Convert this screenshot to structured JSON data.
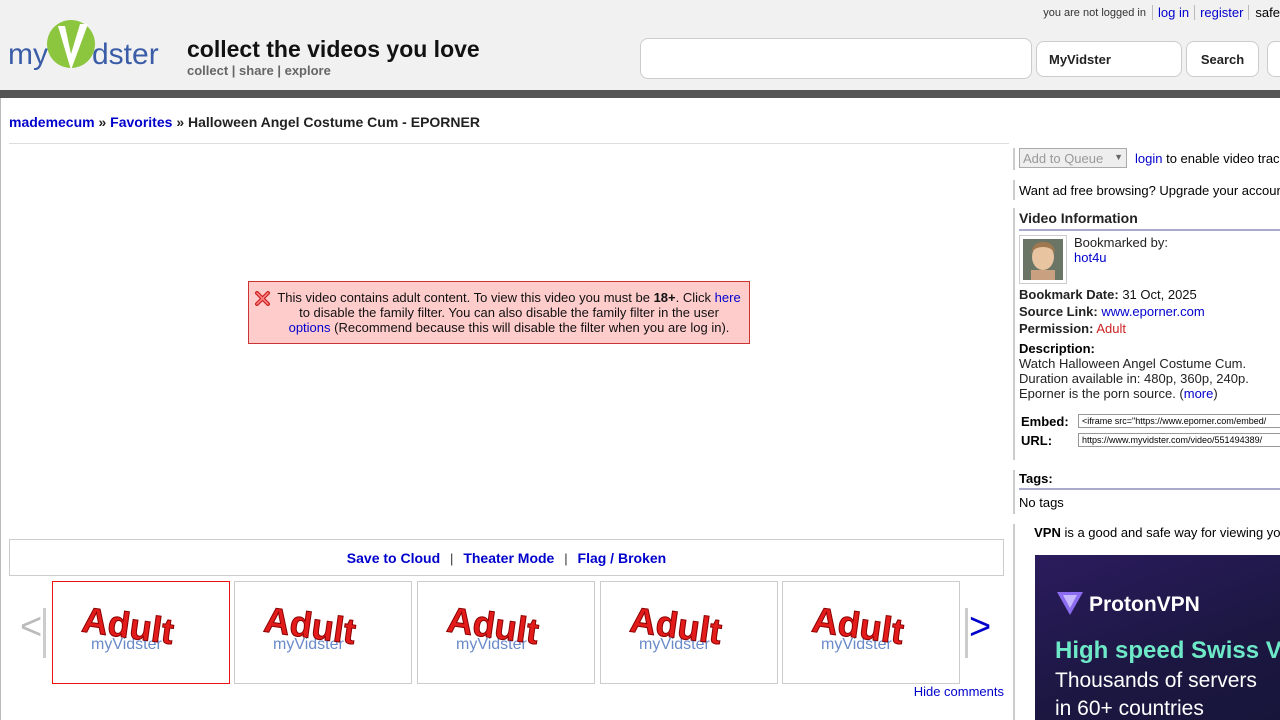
{
  "header": {
    "logo_text": "myVidster",
    "tagline": "collect the videos you love",
    "subtagline": "collect | share | explore",
    "login_status": "you are not logged in",
    "login_link": "log in",
    "register_link": "register",
    "safe_label": "safe",
    "search_value": "",
    "search_scope": "MyVidster",
    "search_button": "Search"
  },
  "breadcrumb": {
    "user": "mademecum",
    "sep1": "»",
    "folder": "Favorites",
    "sep2": "»",
    "title": "Halloween Angel Costume Cum - EPORNER"
  },
  "notice": {
    "text1": "This video contains adult content. To view this video you must be",
    "age": "18+",
    "text2": ". Click",
    "here_link": "here",
    "text3": "to disable the family filter. You can also disable the family filter in the user",
    "options_link": "options",
    "text4": "(Recommend because this will disable the filter when you are log in)."
  },
  "actions": {
    "save": "Save to Cloud",
    "theater": "Theater Mode",
    "flag": "Flag / Broken",
    "sep": "|"
  },
  "thumbnails": {
    "prev": "<",
    "next": ">",
    "items": [
      {
        "label": "Adult"
      },
      {
        "label": "Adult"
      },
      {
        "label": "Adult"
      },
      {
        "label": "Adult"
      },
      {
        "label": "Adult"
      }
    ],
    "watermark": "myVidster",
    "hide_comments": "Hide comments"
  },
  "sidebar": {
    "queue_select": "Add to Queue",
    "login_link": "login",
    "queue_text": "to enable video tracking",
    "adfree_text": "Want ad free browsing? Upgrade your account",
    "video_info_title": "Video Information",
    "bookmarked_by_label": "Bookmarked by:",
    "bookmarked_by_user": "hot4u",
    "bookmark_date_label": "Bookmark Date:",
    "bookmark_date": "31 Oct, 2025",
    "source_link_label": "Source Link:",
    "source_link": "www.eporner.com",
    "permission_label": "Permission:",
    "permission": "Adult",
    "description_label": "Description:",
    "description": "Watch Halloween Angel Costume Cum. Duration available in: 480p, 360p, 240p. Eporner is the porn source. (",
    "more_link": "more",
    "description_end": ")",
    "embed_label": "Embed:",
    "embed_value": "<iframe src=\"https://www.eporner.com/embed/",
    "url_label": "URL:",
    "url_value": "https://www.myvidster.com/video/551494389/",
    "tags_title": "Tags:",
    "tags_value": "No tags",
    "vpn_bold": "VPN",
    "vpn_text": " is a good and safe way for viewing your videos."
  },
  "ad": {
    "brand": "ProtonVPN",
    "headline": "High speed Swiss VPN",
    "line1": "Thousands of servers",
    "line2": "in 60+ countries",
    "colors": {
      "headline": "#6ee9c8",
      "background": "#1c1742"
    }
  }
}
